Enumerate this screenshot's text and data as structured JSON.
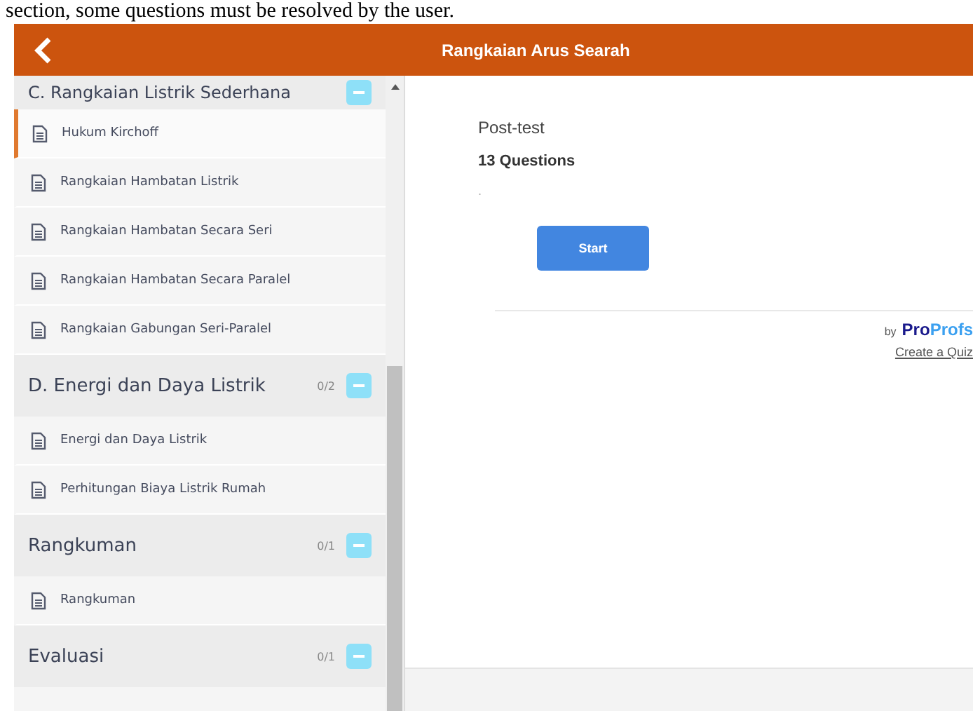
{
  "caption": "section, some questions must be resolved by the user.",
  "header": {
    "title": "Rangkaian Arus Searah"
  },
  "sidebar": {
    "sections": [
      {
        "title": "C. Rangkaian Listrik Sederhana",
        "expanded": true,
        "items": [
          {
            "label": "Hukum Kirchoff",
            "selected": true
          },
          {
            "label": "Rangkaian Hambatan Listrik",
            "selected": false
          },
          {
            "label": "Rangkaian Hambatan Secara Seri",
            "selected": false
          },
          {
            "label": "Rangkaian Hambatan Secara Paralel",
            "selected": false
          },
          {
            "label": "Rangkaian Gabungan Seri-Paralel",
            "selected": false
          }
        ]
      },
      {
        "title": "D. Energi dan Daya Listrik",
        "count": "0/2",
        "expanded": true,
        "items": [
          {
            "label": "Energi dan Daya Listrik",
            "selected": false
          },
          {
            "label": "Perhitungan Biaya Listrik Rumah",
            "selected": false
          }
        ]
      },
      {
        "title": "Rangkuman",
        "count": "0/1",
        "expanded": true,
        "items": [
          {
            "label": "Rangkuman",
            "selected": false
          }
        ]
      },
      {
        "title": "Evaluasi",
        "count": "0/1",
        "expanded": true
      }
    ]
  },
  "quiz": {
    "title": "Post-test",
    "questions": "13 Questions",
    "description": ".",
    "start": "Start",
    "by": "by",
    "brand_a": "Pro",
    "brand_b": "Profs",
    "create": "Create a Quiz"
  }
}
